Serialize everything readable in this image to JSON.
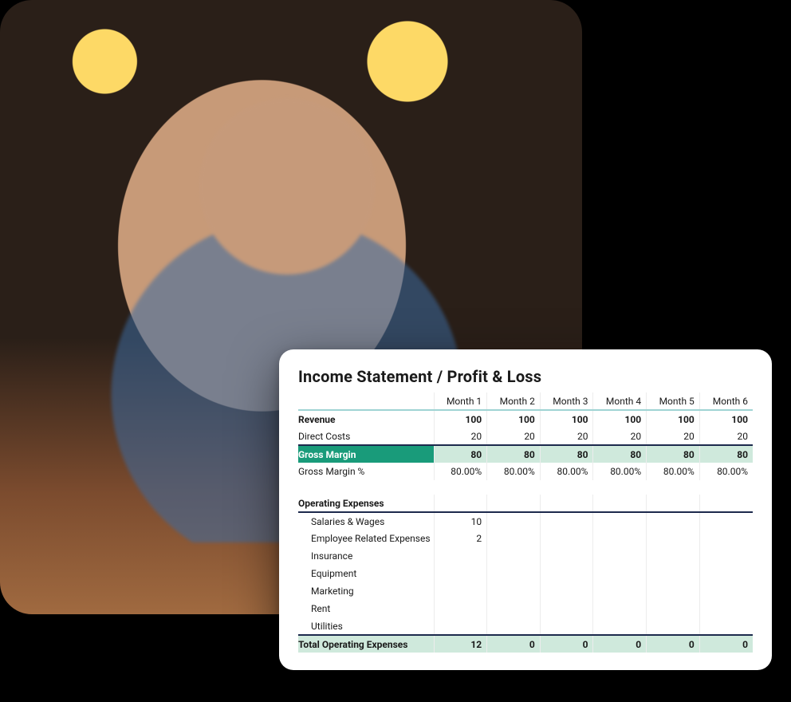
{
  "card": {
    "title": "Income Statement / Profit & Loss",
    "months": [
      "Month 1",
      "Month 2",
      "Month 3",
      "Month 4",
      "Month 5",
      "Month 6"
    ],
    "rows": {
      "revenue": {
        "label": "Revenue",
        "values": [
          "100",
          "100",
          "100",
          "100",
          "100",
          "100"
        ]
      },
      "direct_costs": {
        "label": "Direct Costs",
        "values": [
          "20",
          "20",
          "20",
          "20",
          "20",
          "20"
        ]
      },
      "gross_margin": {
        "label": "Gross Margin",
        "values": [
          "80",
          "80",
          "80",
          "80",
          "80",
          "80"
        ]
      },
      "gross_margin_pct": {
        "label": "Gross Margin %",
        "values": [
          "80.00%",
          "80.00%",
          "80.00%",
          "80.00%",
          "80.00%",
          "80.00%"
        ]
      },
      "opex_header": {
        "label": "Operating Expenses"
      },
      "salaries": {
        "label": "Salaries & Wages",
        "values": [
          "10",
          "",
          "",
          "",
          "",
          ""
        ]
      },
      "emp_related": {
        "label": "Employee Related Expenses",
        "values": [
          "2",
          "",
          "",
          "",
          "",
          ""
        ]
      },
      "insurance": {
        "label": "Insurance",
        "values": [
          "",
          "",
          "",
          "",
          "",
          ""
        ]
      },
      "equipment": {
        "label": "Equipment",
        "values": [
          "",
          "",
          "",
          "",
          "",
          ""
        ]
      },
      "marketing": {
        "label": "Marketing",
        "values": [
          "",
          "",
          "",
          "",
          "",
          ""
        ]
      },
      "rent": {
        "label": "Rent",
        "values": [
          "",
          "",
          "",
          "",
          "",
          ""
        ]
      },
      "utilities": {
        "label": "Utilities",
        "values": [
          "",
          "",
          "",
          "",
          "",
          ""
        ]
      },
      "total_opex": {
        "label": "Total Operating Expenses",
        "values": [
          "12",
          "0",
          "0",
          "0",
          "0",
          "0"
        ]
      }
    }
  }
}
